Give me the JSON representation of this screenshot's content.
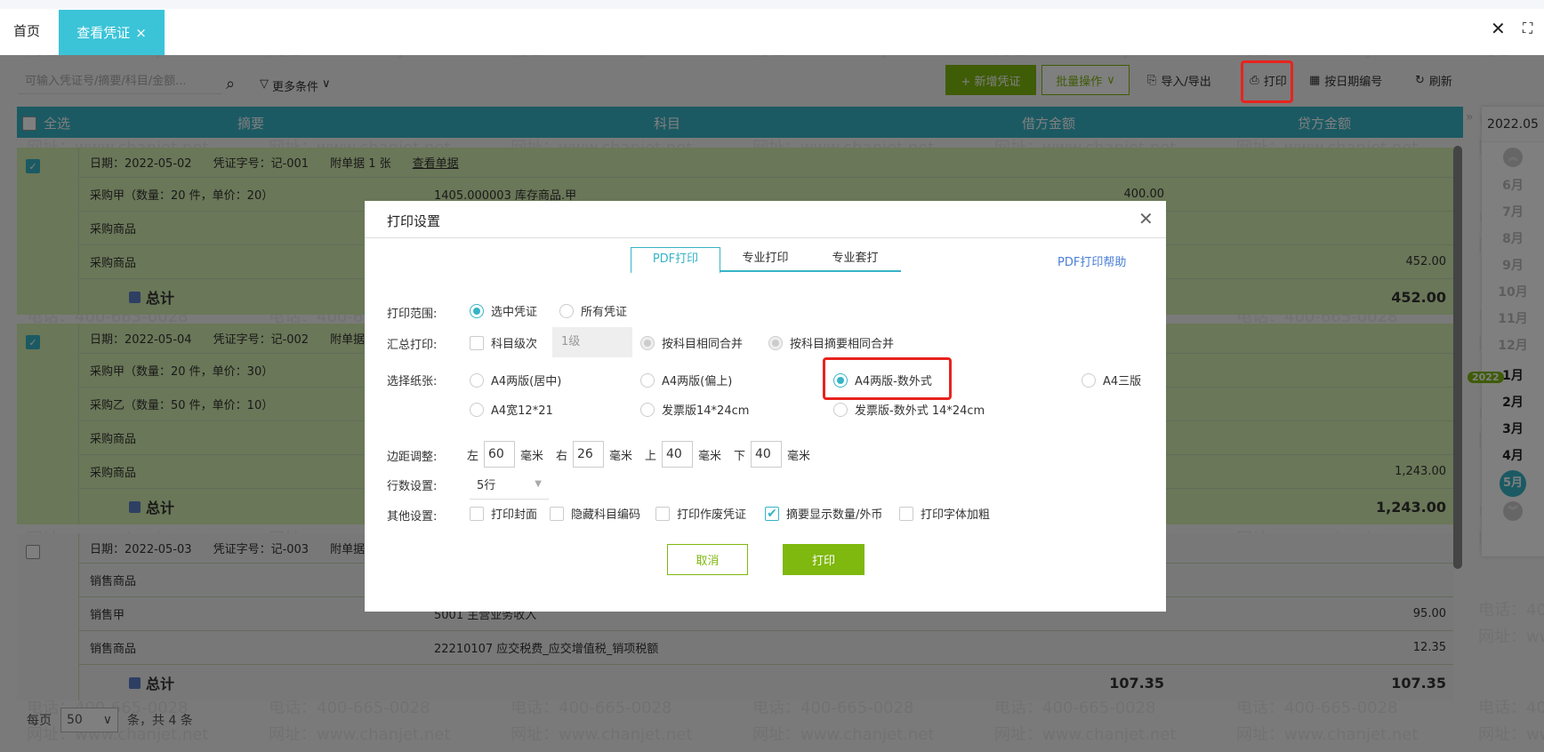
{
  "tabs": {
    "home": "首页",
    "active": "查看凭证",
    "active_close": "×"
  },
  "window": {
    "close": "✕",
    "fullscreen": "⛶"
  },
  "toolbar": {
    "search_placeholder": "可输入凭证号/摘要/科目/金额...",
    "more_filters": "更多条件",
    "new_voucher": "+ 新增凭证",
    "batch": "批量操作",
    "import_export": "导入/导出",
    "print": "打印",
    "number_by_date": "按日期编号",
    "refresh": "刷新"
  },
  "table": {
    "headers": {
      "select_all": "全选",
      "summary": "摘要",
      "account": "科目",
      "debit": "借方金额",
      "credit": "贷方金额"
    },
    "total_label": "总计"
  },
  "vouchers": [
    {
      "checked": true,
      "date": "日期：2022-05-02",
      "no": "凭证字号：记-001",
      "attach": "附单据 1 张",
      "view": "查看单据",
      "lines": [
        [
          "采购甲（数量：20 件，单价：20）",
          "1405.000003  库存商品.甲",
          "400.00",
          ""
        ],
        [
          "采购商品",
          "",
          "",
          ""
        ],
        [
          "采购商品",
          "",
          "",
          "452.00"
        ]
      ],
      "total": {
        "debit": "",
        "credit": "452.00"
      }
    },
    {
      "checked": true,
      "date": "日期：2022-05-04",
      "no": "凭证字号：记-002",
      "attach": "附单据",
      "view": "",
      "lines": [
        [
          "采购甲（数量：20 件，单价：30）",
          "",
          "",
          ""
        ],
        [
          "采购乙（数量：50 件，单价：10）",
          "",
          "",
          ""
        ],
        [
          "采购商品",
          "",
          "",
          ""
        ],
        [
          "采购商品",
          "",
          "",
          "1,243.00"
        ]
      ],
      "total": {
        "debit": "",
        "credit": "1,243.00"
      }
    },
    {
      "checked": false,
      "date": "日期：2022-05-03",
      "no": "凭证字号：记-003",
      "attach": "附单据",
      "view": "",
      "lines": [
        [
          "销售商品",
          "",
          "",
          ""
        ],
        [
          "销售甲",
          "5001 主营业务收入",
          "",
          "95.00"
        ],
        [
          "销售商品",
          "22210107 应交税费_应交增值税_销项税额",
          "",
          "12.35"
        ]
      ],
      "total": {
        "debit": "107.35",
        "credit": "107.35"
      }
    }
  ],
  "date_panel": {
    "current": "2022.05",
    "year_badge": "2022",
    "months_prev": [
      "6月",
      "7月",
      "8月",
      "9月",
      "10月",
      "11月",
      "12月"
    ],
    "months": [
      "1月",
      "2月",
      "3月",
      "4月"
    ],
    "active_month": "5月"
  },
  "pager": {
    "per_page": "每页",
    "size": "50",
    "summary": "条，共 4 条"
  },
  "watermark": {
    "line1": "电话：400-665-0028",
    "line2": "网址：www.chanjet.net"
  },
  "dialog": {
    "title": "打印设置",
    "close": "✕",
    "tabs": [
      "PDF打印",
      "专业打印",
      "专业套打"
    ],
    "help": "PDF打印帮助",
    "range_label": "打印范围:",
    "range_options": [
      "选中凭证",
      "所有凭证"
    ],
    "summary_label": "汇总打印:",
    "summary_level": "科目级次",
    "level_value": "1级",
    "merge_options": [
      "按科目相同合并",
      "按科目摘要相同合并"
    ],
    "paper_label": "选择纸张:",
    "paper_options": [
      "A4两版(居中)",
      "A4两版(偏上)",
      "A4两版-数外式",
      "A4三版",
      "A4宽12*21",
      "发票版14*24cm",
      "发票版-数外式 14*24cm"
    ],
    "margin_label": "边距调整:",
    "margins": [
      {
        "side": "左",
        "value": "60"
      },
      {
        "side": "右",
        "value": "26"
      },
      {
        "side": "上",
        "value": "40"
      },
      {
        "side": "下",
        "value": "40"
      }
    ],
    "unit": "毫米",
    "rows_label": "行数设置:",
    "rows_value": "5行",
    "other_label": "其他设置:",
    "other_options": [
      {
        "label": "打印封面",
        "checked": false
      },
      {
        "label": "隐藏科目编码",
        "checked": false
      },
      {
        "label": "打印作废凭证",
        "checked": false
      },
      {
        "label": "摘要显示数量/外币",
        "checked": true
      },
      {
        "label": "打印字体加粗",
        "checked": false
      }
    ],
    "cancel": "取消",
    "print": "打印"
  },
  "colors": {
    "accent": "#36b4c6",
    "green": "#7fb80e",
    "highlight": "#e8231e"
  }
}
